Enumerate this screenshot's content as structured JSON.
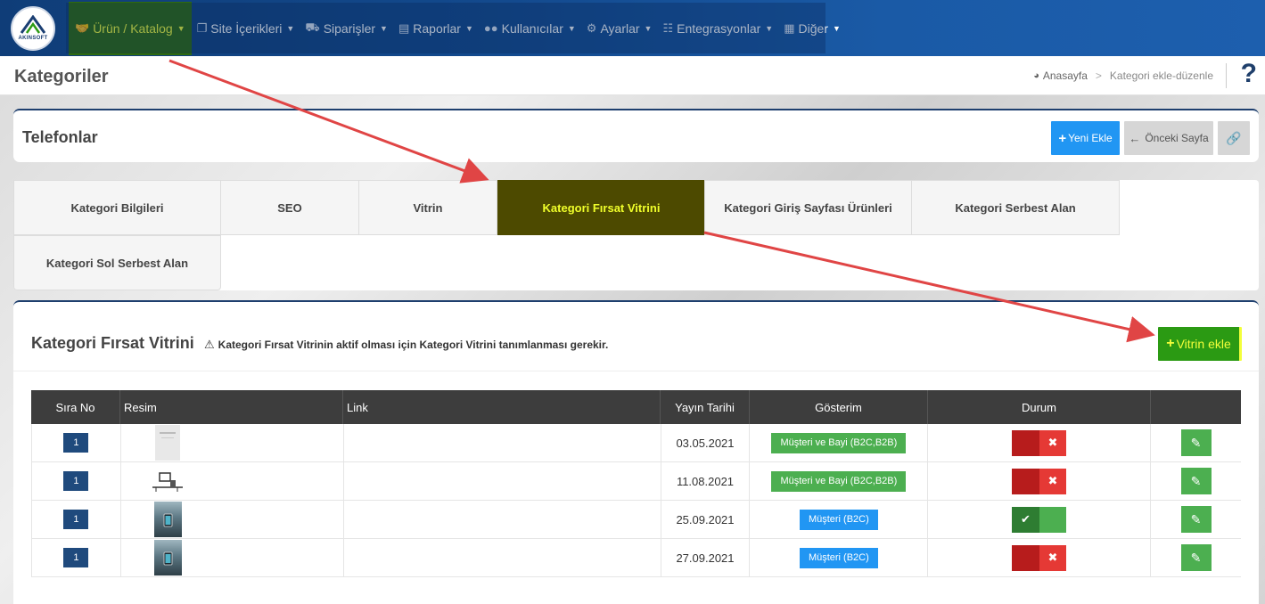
{
  "brand": {
    "logo_text": "AKINSOFT"
  },
  "nav": {
    "items": [
      {
        "label": "Ürün / Katalog",
        "icon": "handshake-icon"
      },
      {
        "label": "Site İçerikleri",
        "icon": "copy-icon"
      },
      {
        "label": "Siparişler",
        "icon": "truck-icon"
      },
      {
        "label": "Raporlar",
        "icon": "report-icon"
      },
      {
        "label": "Kullanıcılar",
        "icon": "users-icon"
      },
      {
        "label": "Ayarlar",
        "icon": "gears-icon"
      },
      {
        "label": "Entegrasyonlar",
        "icon": "sitemap-icon"
      },
      {
        "label": "Diğer",
        "icon": "grid-icon"
      }
    ],
    "active_label": "Ürün / Katalog"
  },
  "page": {
    "title": "Kategoriler",
    "breadcrumb": {
      "home": "Anasayfa",
      "separator": ">",
      "current": "Kategori ekle-düzenle"
    },
    "help": "?"
  },
  "sub": {
    "title": "Telefonlar",
    "new_label": "Yeni Ekle",
    "prev_label": "Önceki Sayfa"
  },
  "tabs": [
    {
      "label": "Kategori Bilgileri"
    },
    {
      "label": "SEO"
    },
    {
      "label": "Vitrin"
    },
    {
      "label": "Kategori Fırsat Vitrini",
      "active": true
    },
    {
      "label": "Kategori Giriş Sayfası Ürünleri"
    },
    {
      "label": "Kategori Serbest Alan"
    },
    {
      "label": "Kategori Sol Serbest Alan"
    }
  ],
  "main": {
    "title": "Kategori Fırsat Vitrini",
    "warning": "Kategori Fırsat Vitrinin aktif olması için Kategori Vitrini tanımlanması gerekir.",
    "add_label": "Vitrin ekle"
  },
  "table": {
    "headers": {
      "sira": "Sıra No",
      "resim": "Resim",
      "link": "Link",
      "tarih": "Yayın Tarihi",
      "gosterim": "Gösterim",
      "durum": "Durum"
    },
    "rows": [
      {
        "sira": "1",
        "link": "",
        "tarih": "03.05.2021",
        "gosterim": "Müşteri ve Bayi (B2C,B2B)",
        "gosterim_color": "green",
        "durum": "off"
      },
      {
        "sira": "1",
        "link": "",
        "tarih": "11.08.2021",
        "gosterim": "Müşteri ve Bayi (B2C,B2B)",
        "gosterim_color": "green",
        "durum": "off"
      },
      {
        "sira": "1",
        "link": "",
        "tarih": "25.09.2021",
        "gosterim": "Müşteri (B2C)",
        "gosterim_color": "blue",
        "durum": "on"
      },
      {
        "sira": "1",
        "link": "",
        "tarih": "27.09.2021",
        "gosterim": "Müşteri (B2C)",
        "gosterim_color": "blue",
        "durum": "off"
      }
    ]
  },
  "colors": {
    "nav_bg": "#134a8e",
    "active_nav": "#2f6b0e",
    "active_tab": "#4d4a00",
    "highlight_text": "#f3ff3a",
    "arrow": "#e04545"
  }
}
